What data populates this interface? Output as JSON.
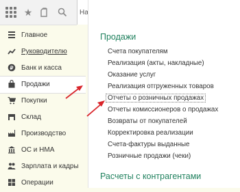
{
  "toolbar": {
    "home_tab_label": "Начальная страница",
    "icons": [
      "grid-icon",
      "star-icon",
      "clipboard-icon",
      "search-icon"
    ]
  },
  "sidebar": {
    "items": [
      {
        "label": "Главное",
        "icon": "menu-lines-icon"
      },
      {
        "label": "Руководителю",
        "icon": "chart-line-icon"
      },
      {
        "label": "Банк и касса",
        "icon": "coin-icon"
      },
      {
        "label": "Продажи",
        "icon": "bag-icon",
        "active": true
      },
      {
        "label": "Покупки",
        "icon": "cart-icon"
      },
      {
        "label": "Склад",
        "icon": "warehouse-icon"
      },
      {
        "label": "Производство",
        "icon": "factory-icon"
      },
      {
        "label": "ОС и НМА",
        "icon": "building-icon"
      },
      {
        "label": "Зарплата и кадры",
        "icon": "people-icon"
      },
      {
        "label": "Операции",
        "icon": "operations-icon"
      }
    ]
  },
  "panel": {
    "section1_title": "Продажи",
    "links": [
      "Счета покупателям",
      "Реализация (акты, накладные)",
      "Оказание услуг",
      "Реализация отгруженных товаров",
      "Отчеты о розничных продажах",
      "Отчеты комиссионеров о продажах",
      "Возвраты от покупателей",
      "Корректировка реализации",
      "Счета-фактуры выданные",
      "Розничные продажи (чеки)"
    ],
    "section2_title": "Расчеты с контрагентами"
  },
  "colors": {
    "sidebar_bg": "#fbfbeb",
    "section_title": "#20815e",
    "arrow": "#d9252a",
    "icon": "#444444"
  }
}
